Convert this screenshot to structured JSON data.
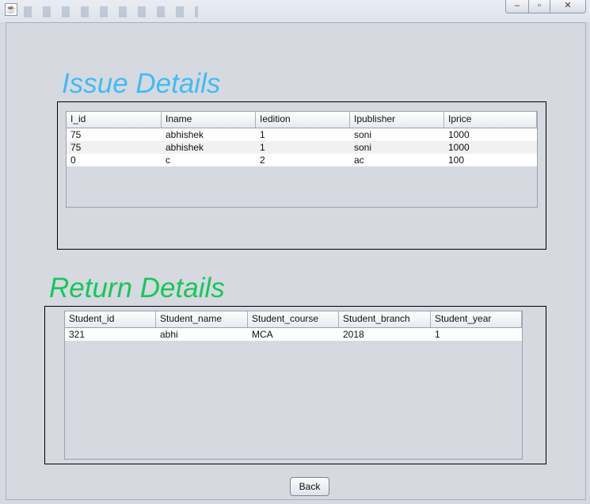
{
  "window": {
    "app_icon": "java-cup-icon",
    "controls": {
      "minimize": "–",
      "maximize": "▫",
      "close": "✕"
    }
  },
  "issue": {
    "heading": "Issue Details",
    "columns": [
      "I_id",
      "Iname",
      "Iedition",
      "Ipublisher",
      "Iprice"
    ],
    "rows": [
      [
        "75",
        "abhishek",
        "1",
        "soni",
        "1000"
      ],
      [
        "75",
        "abhishek",
        "1",
        "soni",
        "1000"
      ],
      [
        "0",
        "c",
        "2",
        "ac",
        "100"
      ]
    ]
  },
  "return": {
    "heading": "Return Details",
    "columns": [
      "Student_id",
      "Student_name",
      "Student_course",
      "Student_branch",
      "Student_year"
    ],
    "rows": [
      [
        "321",
        "abhi",
        "MCA",
        "2018",
        "1"
      ]
    ]
  },
  "actions": {
    "back_label": "Back"
  },
  "colors": {
    "issue_heading": "#3fbcf4",
    "return_heading": "#16c75a",
    "panel_bg": "#d6d9e0"
  }
}
